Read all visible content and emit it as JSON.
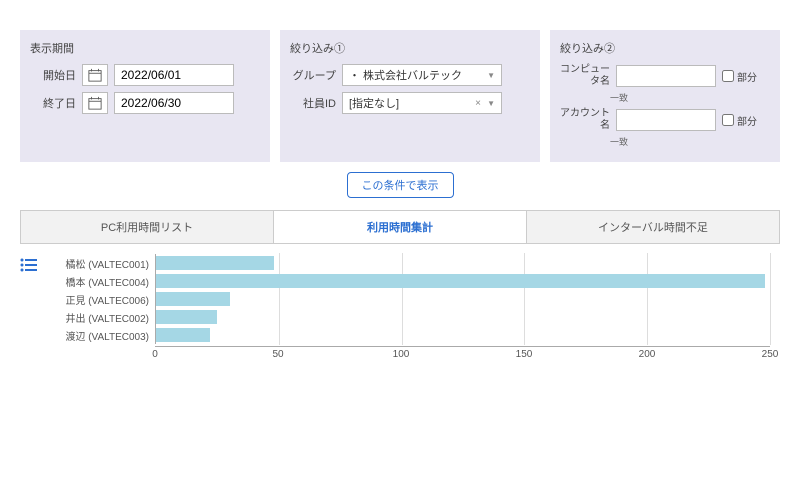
{
  "period": {
    "title": "表示期間",
    "start_label": "開始日",
    "start_value": "2022/06/01",
    "end_label": "終了日",
    "end_value": "2022/06/30"
  },
  "filter1": {
    "title": "絞り込み①",
    "group_label": "グループ",
    "group_value": "・ 株式会社バルテック",
    "employee_label": "社員ID",
    "employee_value": "[指定なし]"
  },
  "filter2": {
    "title": "絞り込み②",
    "computer_label": "コンピュータ名",
    "computer_value": "",
    "account_label": "アカウント名",
    "account_value": "",
    "match_text": "一致",
    "partial_label": "部分"
  },
  "submit_label": "この条件で表示",
  "tabs": {
    "t1": "PC利用時間リスト",
    "t2": "利用時間集計",
    "t3": "インターバル時間不足"
  },
  "chart_data": {
    "type": "bar",
    "title": "",
    "xlabel": "",
    "ylabel": "",
    "ylim": [
      0,
      250
    ],
    "ticks": [
      0,
      50,
      100,
      150,
      200,
      250
    ],
    "categories": [
      "橘松 (VALTEC001)",
      "橋本 (VALTEC004)",
      "正見 (VALTEC006)",
      "井出 (VALTEC002)",
      "渡辺 (VALTEC003)"
    ],
    "values": [
      48,
      248,
      30,
      25,
      22
    ]
  }
}
